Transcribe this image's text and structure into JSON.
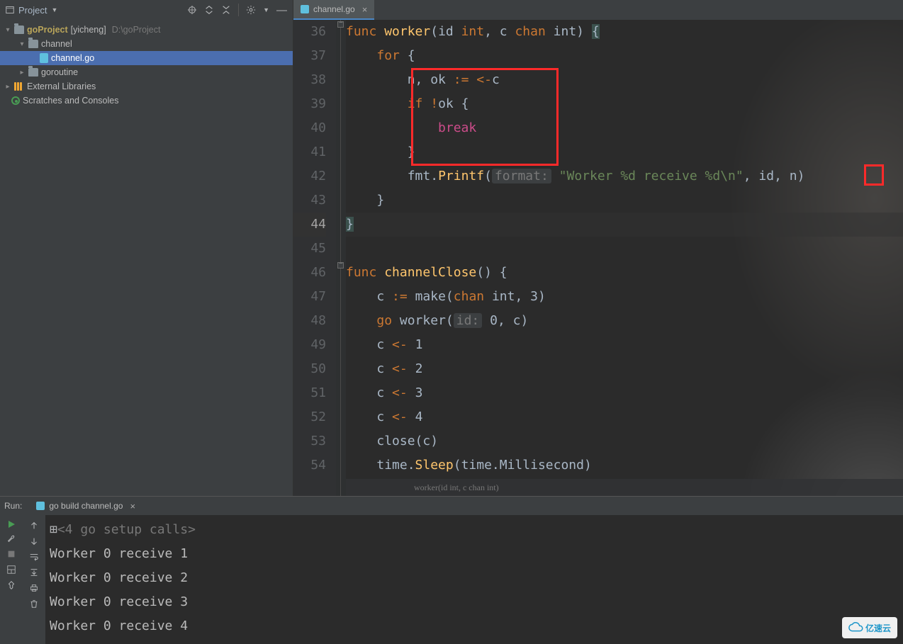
{
  "toolbar": {
    "project_label": "Project"
  },
  "tab": {
    "filename": "channel.go"
  },
  "tree": {
    "root": {
      "name": "goProject",
      "branch": "[yicheng]",
      "path": "D:\\goProject"
    },
    "channel_folder": "channel",
    "channel_file": "channel.go",
    "goroutine_folder": "goroutine",
    "ext_lib": "External Libraries",
    "scratches": "Scratches and Consoles"
  },
  "gutter": [
    "36",
    "37",
    "38",
    "39",
    "40",
    "41",
    "42",
    "43",
    "44",
    "45",
    "46",
    "47",
    "48",
    "49",
    "50",
    "51",
    "52",
    "53",
    "54"
  ],
  "code": {
    "l36": {
      "func": "func",
      "name": "worker",
      "p1": "(id ",
      "ty1": "int",
      "p2": ", c ",
      "ty2": "chan",
      "p3": " int) ",
      "brace": "{"
    },
    "l37": {
      "for": "for",
      "brace": "{"
    },
    "l38": {
      "txt1": "n, ok ",
      "ass": ":=",
      "txt2": " ",
      "arrow": "<-",
      "txt3": "c"
    },
    "l39": {
      "if": "if",
      "sp": " ",
      "bang": "!",
      "ok": "ok ",
      "brace": "{"
    },
    "l40": {
      "break": "break"
    },
    "l41": {
      "brace": "}"
    },
    "l42": {
      "txt1": "fmt.",
      "fn": "Printf",
      "p1": "(",
      "hint": "format:",
      "sp": " ",
      "str": "\"Worker %d receive %d\\n\"",
      "p2": ", id, ",
      "n": "n",
      "p3": ")"
    },
    "l43": {
      "brace": "}"
    },
    "l44": {
      "brace": "}"
    },
    "l46": {
      "func": "func",
      "name": "channelClose",
      "p": "() {"
    },
    "l47": {
      "c": "c ",
      "ass": ":=",
      "txt": " make(",
      "chan": "chan",
      "rest": " int, 3)"
    },
    "l48": {
      "go": "go",
      "txt1": " worker(",
      "hint": "id:",
      "sp": " ",
      "txt2": "0, c)"
    },
    "l49": {
      "c": "c ",
      "arrow": "<-",
      "txt": " 1"
    },
    "l50": {
      "c": "c ",
      "arrow": "<-",
      "txt": " 2"
    },
    "l51": {
      "c": "c ",
      "arrow": "<-",
      "txt": " 3"
    },
    "l52": {
      "c": "c ",
      "arrow": "<-",
      "txt": " 4"
    },
    "l53": {
      "txt": "close(c)"
    },
    "l54": {
      "txt1": "time.",
      "fn": "Sleep",
      "txt2": "(time.Millisecond)"
    }
  },
  "breadcrumb": "worker(id int, c chan int)",
  "run": {
    "label": "Run:",
    "config": "go build channel.go",
    "lines": [
      "<4 go setup calls>",
      "Worker 0 receive 1",
      "Worker 0 receive 2",
      "Worker 0 receive 3",
      "Worker 0 receive 4"
    ]
  },
  "watermark": "亿速云"
}
